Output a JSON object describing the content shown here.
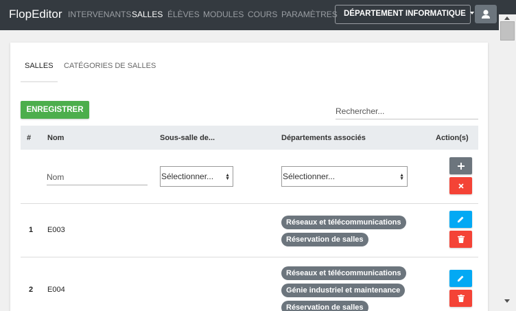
{
  "navbar": {
    "brand": "FlopEditor",
    "links": [
      "INTERVENANTS",
      "SALLES",
      "ÉLÈVES",
      "MODULES",
      "COURS",
      "PARAMÈTRES"
    ],
    "active_link": "SALLES",
    "department": "DÉPARTEMENT INFORMATIQUE",
    "user_icon": "user-icon"
  },
  "tabs": {
    "active": "SALLES",
    "inactive": "CATÉGORIES DE SALLES"
  },
  "toolbar": {
    "save_label": "ENREGISTRER",
    "search_placeholder": "Rechercher...",
    "save_color": "#4cae4c"
  },
  "table": {
    "headers": [
      "#",
      "Nom",
      "Sous-salle de...",
      "Départements associés",
      "Action(s)"
    ],
    "new_row": {
      "name_placeholder": "Nom",
      "subroom_select": "Sélectionner...",
      "departments_select": "Sélectionner...",
      "add_icon": "plus-icon",
      "clear_icon": "close-icon"
    },
    "rows": [
      {
        "num": "1",
        "name": "E003",
        "departments": [
          "Réseaux et télécommunications",
          "Réservation de salles"
        ]
      },
      {
        "num": "2",
        "name": "E004",
        "departments": [
          "Réseaux et télécommunications",
          "Génie industriel et maintenance",
          "Réservation de salles"
        ]
      }
    ],
    "edit_icon": "pencil-icon",
    "delete_icon": "trash-icon",
    "colors": {
      "edit": "#03a9f4",
      "delete": "#f44336",
      "add": "#6c757d",
      "chip": "#6c757d"
    }
  }
}
